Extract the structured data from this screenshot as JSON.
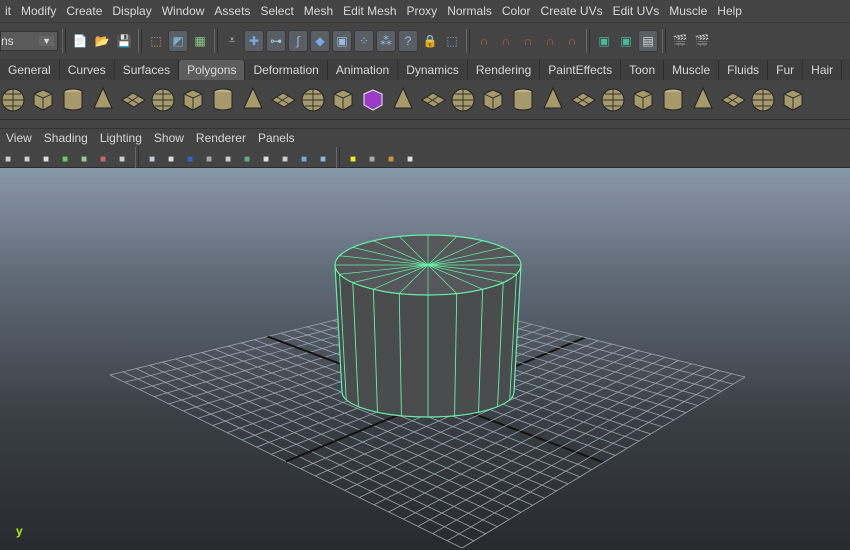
{
  "menu": [
    "it",
    "Modify",
    "Create",
    "Display",
    "Window",
    "Assets",
    "Select",
    "Mesh",
    "Edit Mesh",
    "Proxy",
    "Normals",
    "Color",
    "Create UVs",
    "Edit UVs",
    "Muscle",
    "Help"
  ],
  "mode_selector": {
    "value": "ns"
  },
  "status_icons": [
    {
      "name": "new-scene-icon",
      "glyph": "📄",
      "c": "#eee"
    },
    {
      "name": "open-scene-icon",
      "glyph": "📂",
      "c": "#c9b24a"
    },
    {
      "name": "save-scene-icon",
      "glyph": "💾",
      "c": "#ccc"
    },
    {
      "sep": true
    },
    {
      "name": "select-hierarchy-icon",
      "glyph": "⬚",
      "c": "#c96"
    },
    {
      "name": "select-object-icon",
      "glyph": "◩",
      "c": "#7ac",
      "btn": true
    },
    {
      "name": "select-component-icon",
      "glyph": "▦",
      "c": "#8c8"
    },
    {
      "sep": true
    },
    {
      "name": "filter-icon",
      "glyph": "⩡",
      "c": "#ccc"
    },
    {
      "name": "snap-grid-icon",
      "glyph": "✚",
      "c": "#7ad",
      "btn": true
    },
    {
      "name": "snap-vertex-icon",
      "glyph": "⊶",
      "c": "#acd",
      "btn": true
    },
    {
      "name": "snap-curve-icon",
      "glyph": "∫",
      "c": "#9bd",
      "btn": true
    },
    {
      "name": "snap-face-icon",
      "glyph": "◆",
      "c": "#7ad",
      "btn": true
    },
    {
      "name": "snap-bounding-icon",
      "glyph": "▣",
      "c": "#9bd",
      "btn": true
    },
    {
      "name": "snap-points-icon",
      "glyph": "⁘",
      "c": "#9bd",
      "btn": true
    },
    {
      "name": "particles-icon",
      "glyph": "⁂",
      "c": "#9bd",
      "btn": true
    },
    {
      "name": "help-icon",
      "glyph": "?",
      "c": "#9bd",
      "btn": true
    },
    {
      "name": "lock-icon",
      "glyph": "🔒",
      "c": "#db3"
    },
    {
      "name": "select-box-icon",
      "glyph": "⬚",
      "c": "#7ad"
    },
    {
      "sep": true
    },
    {
      "name": "magnet-grid-icon",
      "glyph": "∩",
      "c": "#c54"
    },
    {
      "name": "magnet-curve-icon",
      "glyph": "∩",
      "c": "#c54"
    },
    {
      "name": "magnet-point-icon",
      "glyph": "∩",
      "c": "#c54"
    },
    {
      "name": "magnet-plane-icon",
      "glyph": "∩",
      "c": "#c54"
    },
    {
      "name": "magnet-live-icon",
      "glyph": "∩",
      "c": "#c54"
    },
    {
      "sep": true
    },
    {
      "name": "input-ops-icon",
      "glyph": "▣",
      "c": "#4b9"
    },
    {
      "name": "output-ops-icon",
      "glyph": "▣",
      "c": "#4b9"
    },
    {
      "name": "history-icon",
      "glyph": "▤",
      "c": "#ddd",
      "btn": true
    },
    {
      "sep": true
    },
    {
      "name": "render-settings-icon",
      "glyph": "🎬",
      "c": "#ddd"
    },
    {
      "name": "render-frame-icon",
      "glyph": "🎬",
      "c": "#ddd"
    }
  ],
  "shelf_tabs": [
    "General",
    "Curves",
    "Surfaces",
    "Polygons",
    "Deformation",
    "Animation",
    "Dynamics",
    "Rendering",
    "PaintEffects",
    "Toon",
    "Muscle",
    "Fluids",
    "Fur",
    "Hair"
  ],
  "active_shelf": "Polygons",
  "shelf_icons": [
    "poly-sphere-icon",
    "poly-cube-icon",
    "poly-cylinder-icon",
    "poly-cone-icon",
    "poly-plane-icon",
    "poly-torus-icon",
    "poly-pyramid-icon",
    "poly-pipe-icon",
    "poly-helix-icon",
    "combine-icon",
    "separate-icon",
    "extract-icon",
    "smooth-proxy-icon",
    "mirror-icon",
    "boolean-icon",
    "extrude-icon",
    "bridge-icon",
    "append-polygon-icon",
    "split-polygon-icon",
    "bevel-icon",
    "merge-icon",
    "collapse-icon",
    "insert-edge-loop-icon",
    "offset-edge-loop-icon",
    "poke-icon",
    "wedge-icon",
    "sculpt-icon"
  ],
  "panel_menu": [
    "View",
    "Shading",
    "Lighting",
    "Show",
    "Renderer",
    "Panels"
  ],
  "panel_icons": [
    "camera-attr-icon",
    "camera-tools-icon",
    "bookmarks-icon",
    "image-plane-icon",
    "film-gate-icon",
    "grid-toggle-icon",
    "resolution-gate-icon",
    "wireframe-icon",
    "smooth-shade-icon",
    "xray-icon",
    "isolate-icon",
    "textured-icon",
    "wireframe-on-shaded-icon",
    "default-light-icon",
    "all-lights-icon",
    "flat-light-icon",
    "shadows-icon",
    "select-camera-icon",
    "isolate-select-icon",
    "backface-icon",
    "cube-view-icon"
  ],
  "viewport": {
    "axis_label": "y",
    "mesh_color": "#4a4b4d",
    "wire_color": "#66f0a8",
    "grid_color": "#9aa3ad"
  }
}
